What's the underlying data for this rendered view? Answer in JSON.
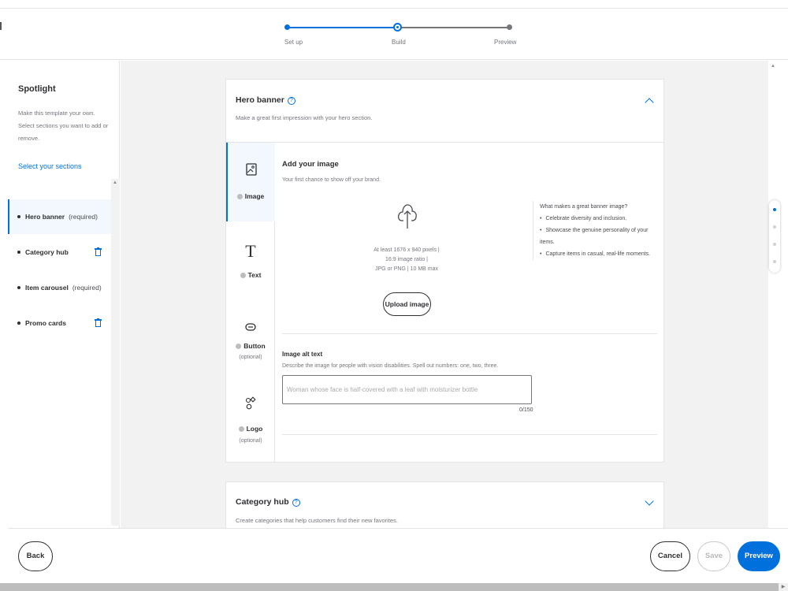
{
  "stepper": {
    "steps": [
      {
        "label": "Set up",
        "state": "done"
      },
      {
        "label": "Build",
        "state": "current"
      },
      {
        "label": "Preview",
        "state": "todo"
      }
    ]
  },
  "sidebar": {
    "title": "Spotlight",
    "description": "Make this template your own. Select sections you want to add or remove.",
    "select_link": "Select your sections",
    "items": [
      {
        "name": "Hero banner",
        "suffix": "(required)",
        "active": true,
        "deletable": false
      },
      {
        "name": "Category hub",
        "suffix": "",
        "active": false,
        "deletable": true
      },
      {
        "name": "Item carousel",
        "suffix": "(required)",
        "active": false,
        "deletable": false
      },
      {
        "name": "Promo cards",
        "suffix": "",
        "active": false,
        "deletable": true
      }
    ]
  },
  "hero": {
    "title": "Hero banner",
    "help": "?",
    "subtitle": "Make a great first impression with your hero section.",
    "tabs": [
      {
        "label": "Image",
        "optional": "",
        "icon": "image-icon"
      },
      {
        "label": "Text",
        "optional": "",
        "icon": "text-icon"
      },
      {
        "label": "Button",
        "optional": "(optional)",
        "icon": "button-icon"
      },
      {
        "label": "Logo",
        "optional": "(optional)",
        "icon": "logo-icon"
      }
    ],
    "add_image": {
      "title": "Add your image",
      "subtitle": "Your first chance to show off your brand.",
      "req_line1": "At least 1676 x 940 pixels |",
      "req_line2": "16:9 image ratio |",
      "req_line3": "JPG or PNG | 10 MB max",
      "upload_label": "Upload image"
    },
    "tips": {
      "heading": "What makes a great banner image?",
      "items": [
        "Celebrate diversity and inclusion.",
        "Showcase the genuine personality of your items.",
        "Capture items in casual, real-life moments."
      ]
    },
    "alt_text": {
      "label": "Image alt text",
      "help": "Describe the image for people with vision disabilities. Spell out numbers: one, two, three.",
      "placeholder": "Woman whose face is half-covered with a leaf with moisturizer bottle",
      "counter": "0/150"
    }
  },
  "category": {
    "title": "Category hub",
    "help": "?",
    "subtitle": "Create categories that help customers find their new favorites."
  },
  "footer": {
    "back": "Back",
    "cancel": "Cancel",
    "save": "Save",
    "preview": "Preview"
  },
  "colors": {
    "accent": "#0071dc",
    "text": "#2e2f32",
    "muted": "#74767c",
    "canvas": "#f2f2f2"
  }
}
